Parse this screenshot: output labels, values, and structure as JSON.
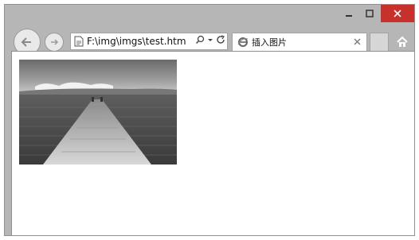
{
  "window": {
    "caption_buttons": {
      "minimize_icon": "minimize-icon",
      "maximize_icon": "maximize-icon",
      "close_icon": "close-icon"
    }
  },
  "toolbar": {
    "back_icon": "arrow-left-icon",
    "forward_icon": "arrow-right-icon",
    "address": {
      "value": "F:\\img\\imgs\\test.htm",
      "page_icon": "document-icon",
      "search_icon": "search-icon",
      "dropdown_icon": "chevron-down-icon",
      "refresh_icon": "refresh-icon"
    },
    "tab": {
      "label": "插入图片",
      "icon": "ie-icon",
      "close_icon": "close-icon"
    },
    "home_icon": "home-icon"
  },
  "colors": {
    "close_button": "#c7302b",
    "chrome": "#b6b6b6"
  }
}
